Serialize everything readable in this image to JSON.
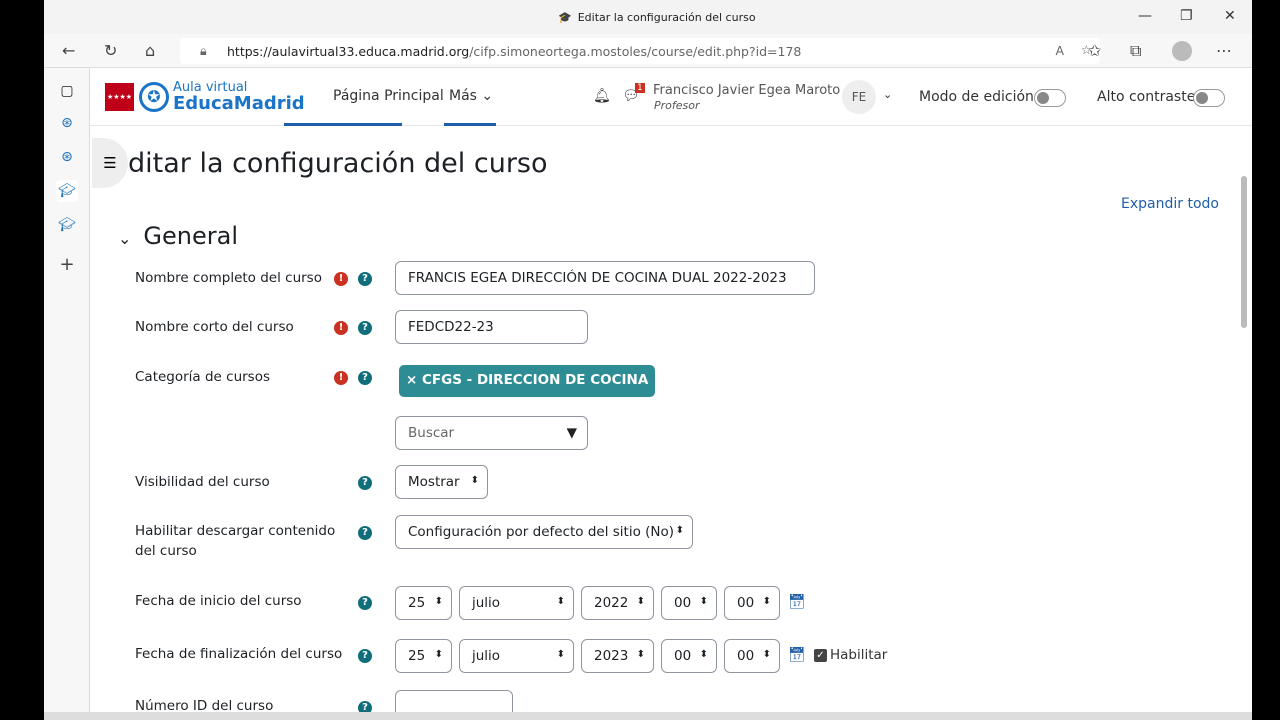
{
  "browser": {
    "tab_title": "Editar la configuración del curso",
    "url_host": "https://aulavirtual33.educa.madrid.org",
    "url_path": "/cifp.simoneortega.mostoles/course/edit.php?id=178"
  },
  "logo": {
    "line1": "Aula virtual",
    "line2": "EducaMadrid"
  },
  "nav": {
    "home": "Página Principal",
    "more": "Más",
    "user_name": "Francisco Javier Egea Maroto",
    "user_role": "Profesor",
    "avatar": "FE",
    "msg_count": "1",
    "edit_mode": "Modo de edición",
    "contrast": "Alto contraste"
  },
  "page": {
    "title": "ditar la configuración del curso",
    "expand_all": "Expandir todo",
    "section": "General"
  },
  "form": {
    "fullname_label": "Nombre completo del curso",
    "fullname_value": "FRANCIS EGEA DIRECCIÓN DE COCINA DUAL 2022-2023",
    "shortname_label": "Nombre corto del curso",
    "shortname_value": "FEDCD22-23",
    "category_label": "Categoría de cursos",
    "category_tag": "× CFGS - DIRECCION DE COCINA",
    "search_placeholder": "Buscar",
    "visibility_label": "Visibilidad del curso",
    "visibility_value": "Mostrar",
    "download_label": "Habilitar descargar contenido del curso",
    "download_value": "Configuración por defecto del sitio (No)",
    "start_label": "Fecha de inicio del curso",
    "start": {
      "day": "25",
      "month": "julio",
      "year": "2022",
      "hour": "00",
      "minute": "00"
    },
    "end_label": "Fecha de finalización del curso",
    "end": {
      "day": "25",
      "month": "julio",
      "year": "2023",
      "hour": "00",
      "minute": "00"
    },
    "end_enable": "Habilitar",
    "idnumber_label": "Número ID del curso"
  }
}
